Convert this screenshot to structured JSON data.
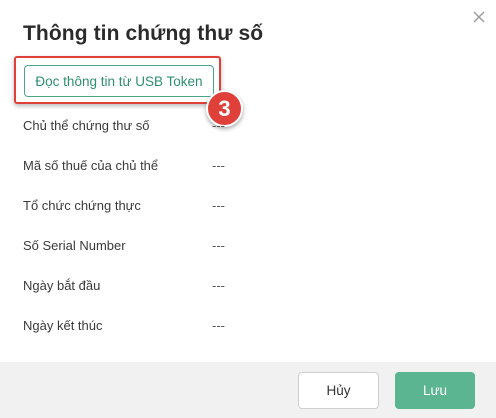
{
  "dialog": {
    "title": "Thông tin chứng thư số",
    "close_icon": "close-icon"
  },
  "actions": {
    "read_token_label": "Đọc thông tin từ USB Token",
    "step_number": "3"
  },
  "fields": [
    {
      "label": "Chủ thể chứng thư số",
      "value": "---"
    },
    {
      "label": "Mã số thuế của chủ thể",
      "value": "---"
    },
    {
      "label": "Tổ chức chứng thực",
      "value": "---"
    },
    {
      "label": "Số Serial Number",
      "value": "---"
    },
    {
      "label": "Ngày bắt đầu",
      "value": "---"
    },
    {
      "label": "Ngày kết thúc",
      "value": "---"
    }
  ],
  "footer": {
    "cancel_label": "Hủy",
    "save_label": "Lưu"
  },
  "colors": {
    "accent": "#5ab590",
    "highlight": "#e0403a",
    "footer_bg": "#f1f1f1"
  }
}
